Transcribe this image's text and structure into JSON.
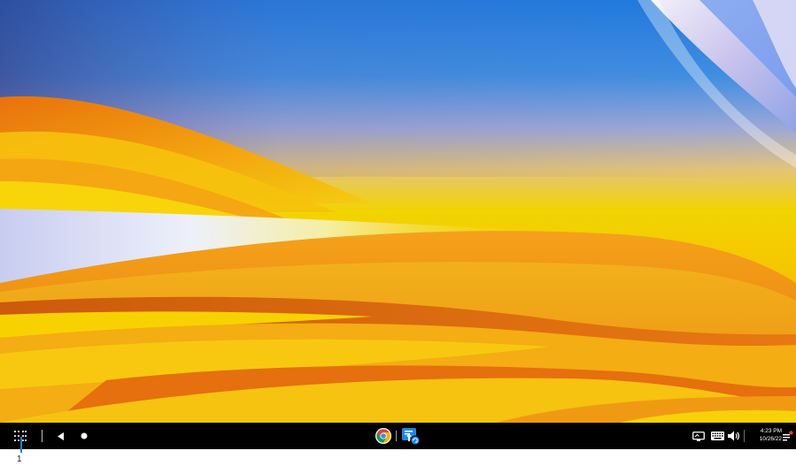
{
  "desktop": {
    "wallpaper": {
      "colors": {
        "sky_blue": "#2a86df",
        "lavender": "#c7c2ea",
        "yellow": "#f2d800",
        "orange": "#ef9313",
        "deep_orange": "#d65b08",
        "white_wave": "#e6e7f4"
      }
    }
  },
  "taskbar": {
    "background": "#000000",
    "left": {
      "launcher_icon": "launcher-grid-icon",
      "back_icon": "back-triangle-icon",
      "home_icon": "home-dot-icon"
    },
    "shelf": {
      "apps": [
        {
          "icon": "chrome-icon"
        },
        {
          "icon": "certificate-app-icon",
          "badge_icon": "refresh-badge-icon"
        }
      ]
    },
    "tray": {
      "cast_icon": "screen-cast-icon",
      "keyboard_icon": "keyboard-icon",
      "volume_icon": "volume-icon",
      "time": "4:23 PM",
      "date": "10/26/22",
      "notification_icon": "notification-icon",
      "notification_dot_color": "#e53935"
    }
  },
  "annotation": {
    "label": "1",
    "line_color": "#1a84c4"
  }
}
